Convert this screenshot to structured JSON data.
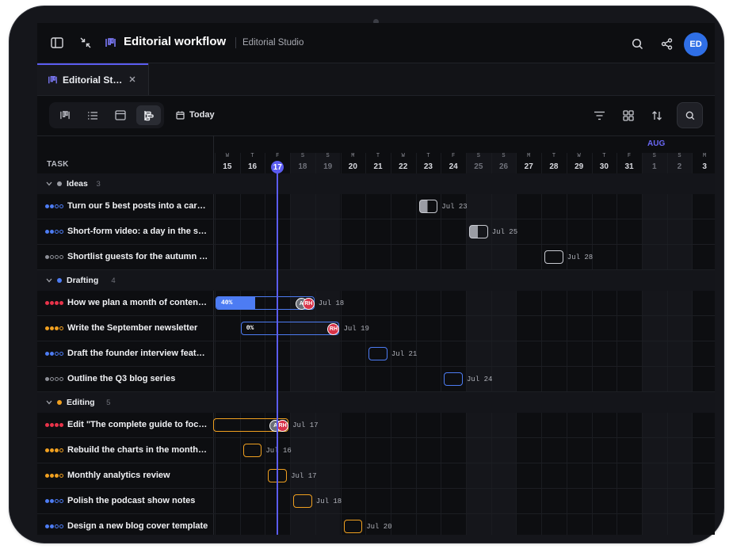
{
  "header": {
    "title": "Editorial workflow",
    "workspace": "Editorial Studio",
    "user_initials": "ED"
  },
  "tab": {
    "label": "Editorial St…"
  },
  "toolbar": {
    "today_label": "Today"
  },
  "timeline": {
    "task_header": "TASK",
    "month_label": "AUG",
    "today_index": 2,
    "days": [
      {
        "w": "W",
        "d": "15"
      },
      {
        "w": "T",
        "d": "16"
      },
      {
        "w": "F",
        "d": "17"
      },
      {
        "w": "S",
        "d": "18"
      },
      {
        "w": "S",
        "d": "19"
      },
      {
        "w": "M",
        "d": "20"
      },
      {
        "w": "T",
        "d": "21"
      },
      {
        "w": "W",
        "d": "22"
      },
      {
        "w": "T",
        "d": "23"
      },
      {
        "w": "F",
        "d": "24"
      },
      {
        "w": "S",
        "d": "25"
      },
      {
        "w": "S",
        "d": "26"
      },
      {
        "w": "M",
        "d": "27"
      },
      {
        "w": "T",
        "d": "28"
      },
      {
        "w": "W",
        "d": "29"
      },
      {
        "w": "T",
        "d": "30"
      },
      {
        "w": "F",
        "d": "31"
      },
      {
        "w": "S",
        "d": "1"
      },
      {
        "w": "S",
        "d": "2"
      },
      {
        "w": "M",
        "d": "3"
      }
    ]
  },
  "groups": [
    {
      "name": "Ideas",
      "count": "3",
      "color": "#9a9ca4",
      "tasks": [
        {
          "name": "Turn our 5 best posts into a caro…",
          "prio": "blue",
          "date": "Jul 23",
          "start": 8,
          "span": 1,
          "style": "idea-half"
        },
        {
          "name": "Short-form video: a day in the st…",
          "prio": "blue",
          "date": "Jul 25",
          "start": 10,
          "span": 1,
          "style": "idea-half"
        },
        {
          "name": "Shortlist guests for the autumn in…",
          "prio": "gray",
          "date": "Jul 28",
          "start": 13,
          "span": 1,
          "style": "idea-empty"
        }
      ]
    },
    {
      "name": "Drafting",
      "count": "4",
      "color": "#4d7cf3",
      "tasks": [
        {
          "name": "How we plan a month of content …",
          "prio": "red",
          "date": "Jul 18",
          "start": 0,
          "span": 4,
          "progress": "40%",
          "progress_value": 40,
          "avatars": [
            "A",
            "RH"
          ],
          "style": "draft"
        },
        {
          "name": "Write the September newsletter",
          "prio": "orange",
          "date": "Jul 19",
          "start": 1,
          "span": 4,
          "progress": "0%",
          "progress_value": 0,
          "avatars": [
            "RH"
          ],
          "style": "draft"
        },
        {
          "name": "Draft the founder interview feature",
          "prio": "blue",
          "date": "Jul 21",
          "start": 6,
          "span": 1,
          "style": "draft"
        },
        {
          "name": "Outline the Q3 blog series",
          "prio": "gray",
          "date": "Jul 24",
          "start": 9,
          "span": 1,
          "style": "draft"
        }
      ]
    },
    {
      "name": "Editing",
      "count": "5",
      "color": "#f0a020",
      "tasks": [
        {
          "name": "Edit \"The complete guide to focus\"",
          "prio": "red",
          "date": "Jul 17",
          "start": -1,
          "span": 4,
          "avatars": [
            "A",
            "RH"
          ],
          "style": "edit"
        },
        {
          "name": "Rebuild the charts in the monthly…",
          "prio": "orange",
          "date": "Jul 16",
          "start": 1,
          "span": 1,
          "style": "edit"
        },
        {
          "name": "Monthly analytics review",
          "prio": "orange",
          "date": "Jul 17",
          "start": 2,
          "span": 1,
          "style": "edit"
        },
        {
          "name": "Polish the podcast show notes",
          "prio": "blue",
          "date": "Jul 18",
          "start": 3,
          "span": 1,
          "style": "edit"
        },
        {
          "name": "Design a new blog cover template",
          "prio": "blue",
          "date": "Jul 20",
          "start": 5,
          "span": 1,
          "style": "edit"
        }
      ]
    }
  ],
  "colors": {
    "accent": "#5b5cf0",
    "prio_red": "#e8334a",
    "prio_orange": "#f0a020",
    "prio_blue": "#4d7cf3",
    "prio_gray": "#8d8f97",
    "drafting": "#4d7cf3",
    "editing": "#f0a020",
    "avatar": "#2f6fe6"
  }
}
